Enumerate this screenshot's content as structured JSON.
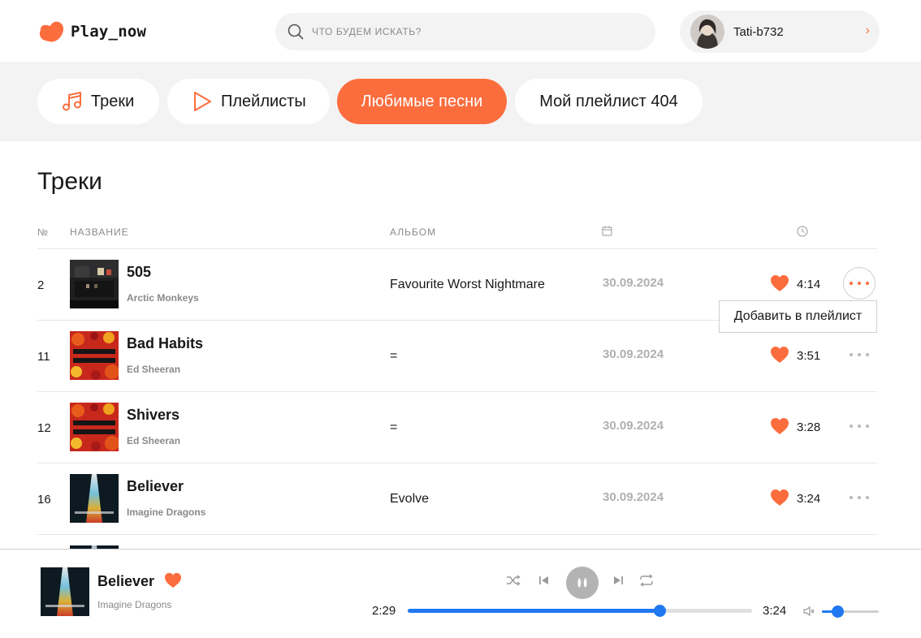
{
  "brand": {
    "name": "Play_now",
    "accent": "#fc6d3e",
    "progress_color": "#1f78f0"
  },
  "search": {
    "placeholder": "ЧТО БУДЕМ ИСКАТЬ?",
    "icon": "search-icon"
  },
  "user": {
    "name": "Tati-b732",
    "chevron": "›"
  },
  "nav": {
    "tabs": [
      {
        "label": "Треки",
        "icon": "music-note-icon",
        "active": false
      },
      {
        "label": "Плейлисты",
        "icon": "play-icon",
        "active": false
      },
      {
        "label": "Любимые песни",
        "active": true
      },
      {
        "label": "Мой плейлист 404",
        "active": false
      }
    ]
  },
  "main": {
    "title": "Треки",
    "columns": {
      "num": "№",
      "name": "НАЗВАНИЕ",
      "album": "АЛЬБОМ",
      "date": "calendar-icon",
      "duration": "clock-icon"
    },
    "tracks": [
      {
        "num": "2",
        "title": "505",
        "artist": "Arctic Monkeys",
        "album": "Favourite Worst Nightmare",
        "date": "30.09.2024",
        "duration": "4:14",
        "liked": true,
        "menu_open": true
      },
      {
        "num": "11",
        "title": "Bad Habits",
        "artist": "Ed Sheeran",
        "album": "=",
        "date": "30.09.2024",
        "duration": "3:51",
        "liked": true,
        "menu_open": false
      },
      {
        "num": "12",
        "title": "Shivers",
        "artist": "Ed Sheeran",
        "album": "=",
        "date": "30.09.2024",
        "duration": "3:28",
        "liked": true,
        "menu_open": false
      },
      {
        "num": "16",
        "title": "Believer",
        "artist": "Imagine Dragons",
        "album": "Evolve",
        "date": "30.09.2024",
        "duration": "3:24",
        "liked": true,
        "menu_open": false
      }
    ],
    "context_menu": {
      "item": "Добавить в плейлист"
    }
  },
  "player": {
    "title": "Believer",
    "artist": "Imagine Dragons",
    "liked": true,
    "current_time": "2:29",
    "total_time": "3:24",
    "progress": 0.73,
    "volume": 0.27,
    "controls": [
      "shuffle-icon",
      "previous-icon",
      "pause-icon",
      "next-icon",
      "repeat-icon"
    ]
  }
}
